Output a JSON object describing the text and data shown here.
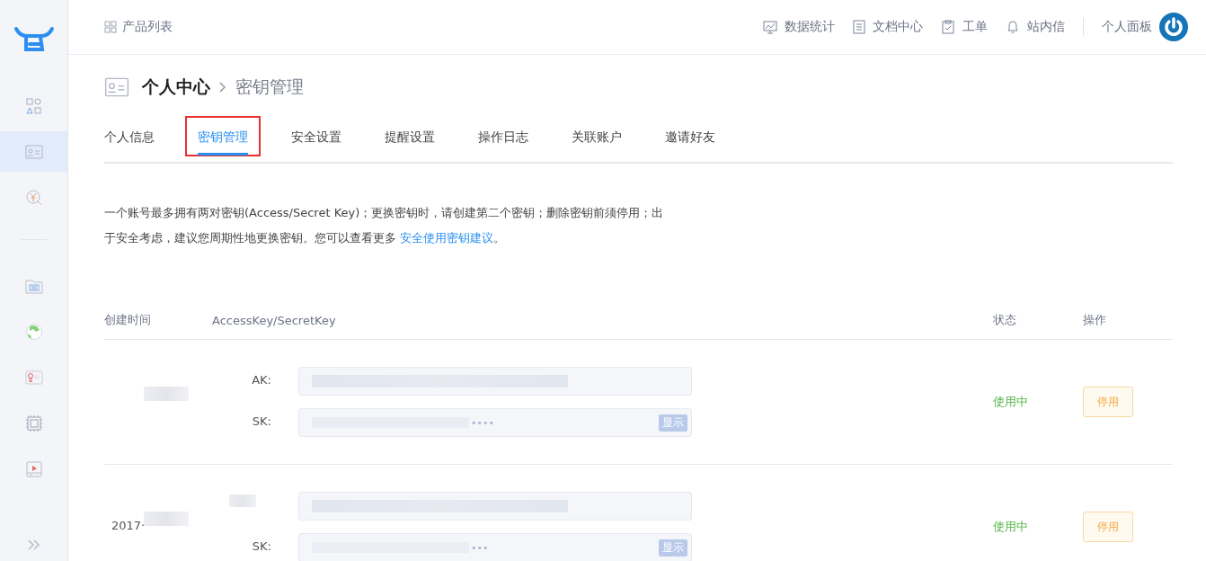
{
  "sidebar": {
    "items": [
      {
        "kind": "products",
        "selected": false
      },
      {
        "kind": "id-card",
        "selected": true
      },
      {
        "kind": "coin",
        "selected": false
      },
      {
        "kind": "folder",
        "selected": false
      },
      {
        "kind": "globe",
        "selected": false
      },
      {
        "kind": "certificate",
        "selected": false
      },
      {
        "kind": "chip",
        "selected": false
      },
      {
        "kind": "video",
        "selected": false
      }
    ]
  },
  "topbar": {
    "product_list": "产品列表",
    "links": [
      {
        "kind": "chart",
        "label": "数据统计"
      },
      {
        "kind": "doc",
        "label": "文档中心"
      },
      {
        "kind": "clipboard",
        "label": "工单"
      },
      {
        "kind": "bell",
        "label": "站内信"
      }
    ],
    "panel": "个人面板"
  },
  "breadcrumb": {
    "root": "个人中心",
    "current": "密钥管理"
  },
  "tabs": [
    {
      "label": "个人信息",
      "selected": false,
      "annotated": false
    },
    {
      "label": "密钥管理",
      "selected": true,
      "annotated": true
    },
    {
      "label": "安全设置",
      "selected": false,
      "annotated": false
    },
    {
      "label": "提醒设置",
      "selected": false,
      "annotated": false
    },
    {
      "label": "操作日志",
      "selected": false,
      "annotated": false
    },
    {
      "label": "关联账户",
      "selected": false,
      "annotated": false
    },
    {
      "label": "邀请好友",
      "selected": false,
      "annotated": false
    }
  ],
  "notice": {
    "text": "一个账号最多拥有两对密钥(Access/Secret Key)；更换密钥时，请创建第二个密钥；删除密钥前须停用；出于安全考虑，建议您周期性地更换密钥。您可以查看更多 ",
    "link": "安全使用密钥建议",
    "end": "。"
  },
  "table": {
    "columns": [
      "创建时间",
      "AccessKey/SecretKey",
      "状态",
      "操作"
    ],
    "rows": [
      {
        "created": "",
        "ak_label": "AK:",
        "sk_label": "SK:",
        "sk_dots": "••••",
        "show": "显示",
        "status": "使用中",
        "action": "停用"
      },
      {
        "created": "2017·",
        "ak_label": "",
        "sk_label": "SK:",
        "sk_dots": "•••",
        "show": "显示",
        "status": "使用中",
        "action": "停用"
      }
    ]
  }
}
